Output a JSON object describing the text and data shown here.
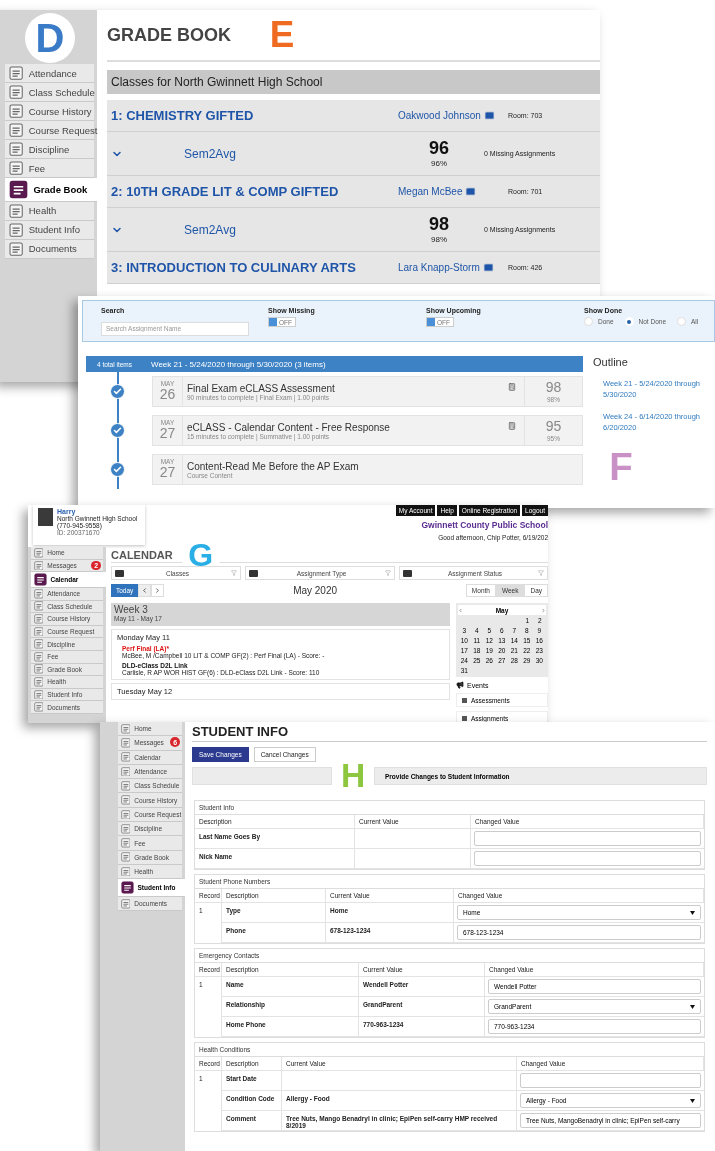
{
  "gradebook": {
    "sidebar": {
      "marker": {
        "letter": "D",
        "color": "#3a7bc8"
      },
      "items": [
        {
          "label": "Attendance",
          "selected": false
        },
        {
          "label": "Class Schedule",
          "selected": false
        },
        {
          "label": "Course History",
          "selected": false
        },
        {
          "label": "Course Request",
          "selected": false
        },
        {
          "label": "Discipline",
          "selected": false
        },
        {
          "label": "Fee",
          "selected": false
        },
        {
          "label": "Grade Book",
          "selected": true
        },
        {
          "label": "Health",
          "selected": false
        },
        {
          "label": "Student Info",
          "selected": false
        },
        {
          "label": "Documents",
          "selected": false
        }
      ]
    },
    "title": "GRADE BOOK",
    "marker": {
      "letter": "E",
      "color": "#ef6b22"
    },
    "school_bar": "Classes for North Gwinnett High School",
    "classes": [
      {
        "title": "1: CHEMISTRY GIFTED",
        "teacher": "Oakwood Johnson",
        "room": "Room: 703",
        "grades": [
          {
            "term": "Sem2Avg",
            "score": "96",
            "percent": "96%",
            "missing": "0 Missing Assignments"
          }
        ]
      },
      {
        "title": "2: 10TH GRADE LIT & COMP GIFTED",
        "teacher": "Megan McBee",
        "room": "Room: 701",
        "grades": [
          {
            "term": "Sem2Avg",
            "score": "98",
            "percent": "98%",
            "missing": "0 Missing Assignments"
          }
        ]
      },
      {
        "title": "3: INTRODUCTION TO CULINARY ARTS",
        "teacher": "Lara Knapp-Storm",
        "room": "Room: 426"
      }
    ]
  },
  "assignments": {
    "marker": {
      "letter": "F",
      "color": "#c991c6"
    },
    "search": {
      "label": "Search",
      "placeholder": "Search Assignment Name"
    },
    "toggles": [
      {
        "label": "Show Missing",
        "on": false,
        "text": "OFF"
      },
      {
        "label": "Show Upcoming",
        "on": false,
        "text": "OFF"
      }
    ],
    "show_done": {
      "label": "Show Done",
      "options": [
        {
          "label": "Done",
          "selected": false
        },
        {
          "label": "Not Done",
          "selected": true
        },
        {
          "label": "All",
          "selected": false
        }
      ]
    },
    "total": "4 total items",
    "week": "Week 21 - 5/24/2020 through 5/30/2020  (3 items)",
    "items": [
      {
        "month": "MAY",
        "day": "26",
        "title": "Final Exam eCLASS Assessment",
        "details": "90 minutes to complete | Final Exam | 1.00 points",
        "score": "98",
        "percent": "98%",
        "done": true
      },
      {
        "month": "MAY",
        "day": "27",
        "title": "eCLASS - Calendar Content - Free Response",
        "details": "15 minutes to complete | Summative | 1.00 points",
        "score": "95",
        "percent": "95%",
        "done": true
      },
      {
        "month": "MAY",
        "day": "27",
        "title": "Content-Read Me Before the AP Exam",
        "details": "Course Content",
        "done": true
      }
    ],
    "outline": {
      "title": "Outline",
      "links": [
        "Week 21 - 5/24/2020 through 5/30/2020",
        "Week 24 - 6/14/2020 through 6/20/2020"
      ]
    }
  },
  "calendar": {
    "marker": {
      "letter": "G",
      "color": "#29aee6"
    },
    "profile": {
      "name": "Harry",
      "school": "North Gwinnett High School",
      "id": "ID: 200371670",
      "phone": "(770-945-9558)"
    },
    "top_links": [
      "My Account",
      "Help",
      "Online Registration",
      "Logout"
    ],
    "district": "Gwinnett County Public School",
    "greeting": "Good afternoon, Chip Potter, 6/19/202",
    "sidebar": [
      {
        "label": "Home",
        "selected": false
      },
      {
        "label": "Messages",
        "selected": false,
        "badge": "2"
      },
      {
        "label": "Calendar",
        "selected": true
      },
      {
        "label": "Attendance",
        "selected": false
      },
      {
        "label": "Class Schedule",
        "selected": false
      },
      {
        "label": "Course History",
        "selected": false
      },
      {
        "label": "Course Request",
        "selected": false
      },
      {
        "label": "Discipline",
        "selected": false
      },
      {
        "label": "Fee",
        "selected": false
      },
      {
        "label": "Grade Book",
        "selected": false
      },
      {
        "label": "Health",
        "selected": false
      },
      {
        "label": "Student Info",
        "selected": false
      },
      {
        "label": "Documents",
        "selected": false
      }
    ],
    "title": "CALENDAR",
    "filters": [
      "Classes",
      "Assignment Type",
      "Assignment Status"
    ],
    "today": "Today",
    "month": "May 2020",
    "views": [
      {
        "label": "Month",
        "selected": false
      },
      {
        "label": "Week",
        "selected": true
      },
      {
        "label": "Day",
        "selected": false
      }
    ],
    "week": {
      "title": "Week 3",
      "range": "May 11 - May 17"
    },
    "days": [
      {
        "title": "Monday May 11",
        "events": [
          {
            "kind": "alert",
            "title": "Perf Final (LA)*",
            "detail": "McBee, M /Campbell 10 LIT & COMP GF(2) : Perf Final (LA) - Score: -"
          },
          {
            "kind": "normal",
            "title": "DLD-eClass D2L Link",
            "detail": "Carlisle, R AP WOR HIST GF(6) : DLD-eClass D2L Link - Score: 110"
          }
        ]
      },
      {
        "title": "Tuesday May 12"
      }
    ],
    "mini_calendar": {
      "month": "May",
      "weeks": [
        {
          "days": [
            "1",
            "2"
          ]
        },
        {
          "days": [
            "3",
            "4",
            "5",
            "6",
            "7",
            "8",
            "9"
          ]
        },
        {
          "days": [
            "10",
            "11",
            "12",
            "13",
            "14",
            "15",
            "16"
          ]
        },
        {
          "days": [
            "17",
            "18",
            "19",
            "20",
            "21",
            "22",
            "23"
          ]
        },
        {
          "days": [
            "24",
            "25",
            "26",
            "27",
            "28",
            "29",
            "30"
          ]
        },
        {
          "days": [
            "31"
          ]
        }
      ]
    },
    "events": {
      "title": "Events",
      "items": [
        {
          "label": "Assessments",
          "checked": true
        },
        {
          "label": "Assignments",
          "checked": true
        }
      ]
    }
  },
  "student_info": {
    "marker": {
      "letter": "H",
      "color": "#8dc63f"
    },
    "sidebar": [
      {
        "label": "Home",
        "selected": false
      },
      {
        "label": "Messages",
        "selected": false,
        "badge": "6"
      },
      {
        "label": "Calendar",
        "selected": false
      },
      {
        "label": "Attendance",
        "selected": false
      },
      {
        "label": "Class Schedule",
        "selected": false
      },
      {
        "label": "Course History",
        "selected": false
      },
      {
        "label": "Course Request",
        "selected": false
      },
      {
        "label": "Discipline",
        "selected": false
      },
      {
        "label": "Fee",
        "selected": false
      },
      {
        "label": "Grade Book",
        "selected": false
      },
      {
        "label": "Health",
        "selected": false
      },
      {
        "label": "Student Info",
        "selected": true
      },
      {
        "label": "Documents",
        "selected": false
      }
    ],
    "title": "STUDENT INFO",
    "buttons": [
      {
        "label": "Save Changes",
        "kind": "primary"
      },
      {
        "label": "Cancel Changes",
        "kind": "secondary"
      }
    ],
    "banner": "Provide Changes to Student Information",
    "sections": [
      {
        "title": "Student Info",
        "columns": [
          "Description",
          "Current Value",
          "Changed Value"
        ],
        "rows": [
          {
            "description": "Last Name Goes By",
            "changed": {
              "kind": "text"
            }
          },
          {
            "description": "Nick Name",
            "changed": {
              "kind": "text"
            }
          }
        ]
      },
      {
        "title": "Student Phone Numbers",
        "columns": [
          "Record",
          "Description",
          "Current Value",
          "Changed Value"
        ],
        "rows": [
          {
            "record": "1",
            "description": "Type",
            "current": "Home",
            "changed": {
              "kind": "select",
              "value": "Home"
            }
          },
          {
            "description": "Phone",
            "current": "678-123-1234",
            "changed": {
              "kind": "text",
              "value": "678-123-1234"
            }
          }
        ]
      },
      {
        "title": "Emergency Contacts",
        "columns": [
          "Record",
          "Description",
          "Current Value",
          "Changed Value"
        ],
        "rows": [
          {
            "record": "1",
            "description": "Name",
            "current": "Wendell Potter",
            "changed": {
              "kind": "text",
              "value": "Wendell Potter"
            }
          },
          {
            "description": "Relationship",
            "current": "GrandParent",
            "changed": {
              "kind": "select",
              "value": "GrandParent"
            }
          },
          {
            "description": "Home Phone",
            "current": "770-963-1234",
            "changed": {
              "kind": "text",
              "value": "770-963-1234"
            }
          }
        ]
      },
      {
        "title": "Health Conditions",
        "columns": [
          "Record",
          "Description",
          "Current Value",
          "Changed Value"
        ],
        "rows": [
          {
            "record": "1",
            "description": "Start Date",
            "changed": {
              "kind": "text"
            }
          },
          {
            "description": "Condition Code",
            "current": "Allergy - Food",
            "changed": {
              "kind": "select",
              "value": "Allergy - Food"
            }
          },
          {
            "description": "Comment",
            "current": "Tree Nuts, Mango Benadryl in clinic; EpiPen self-carry HMP received 8/2019",
            "changed": {
              "kind": "text",
              "value": "Tree Nuts, MangoBenadryl in clinic; EpiPen self-carry"
            }
          }
        ]
      }
    ]
  }
}
